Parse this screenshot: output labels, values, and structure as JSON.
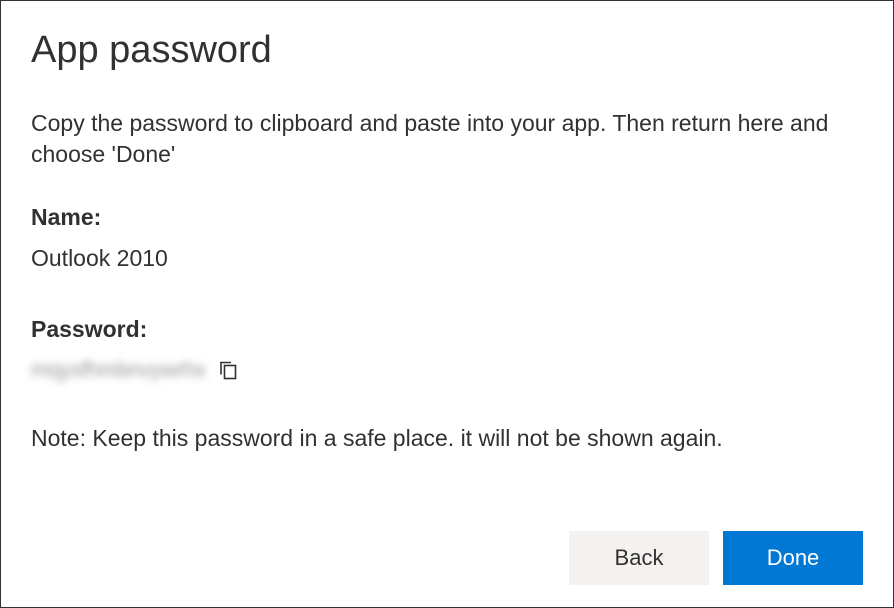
{
  "title": "App password",
  "instruction": "Copy the password to clipboard and paste into your app. Then return here and choose 'Done'",
  "name_label": "Name:",
  "name_value": "Outlook 2010",
  "password_label": "Password:",
  "password_value": "mqyxfhmbnvywrhx",
  "note": "Note: Keep this password in a safe place. it will not be shown again.",
  "buttons": {
    "back": "Back",
    "done": "Done"
  }
}
